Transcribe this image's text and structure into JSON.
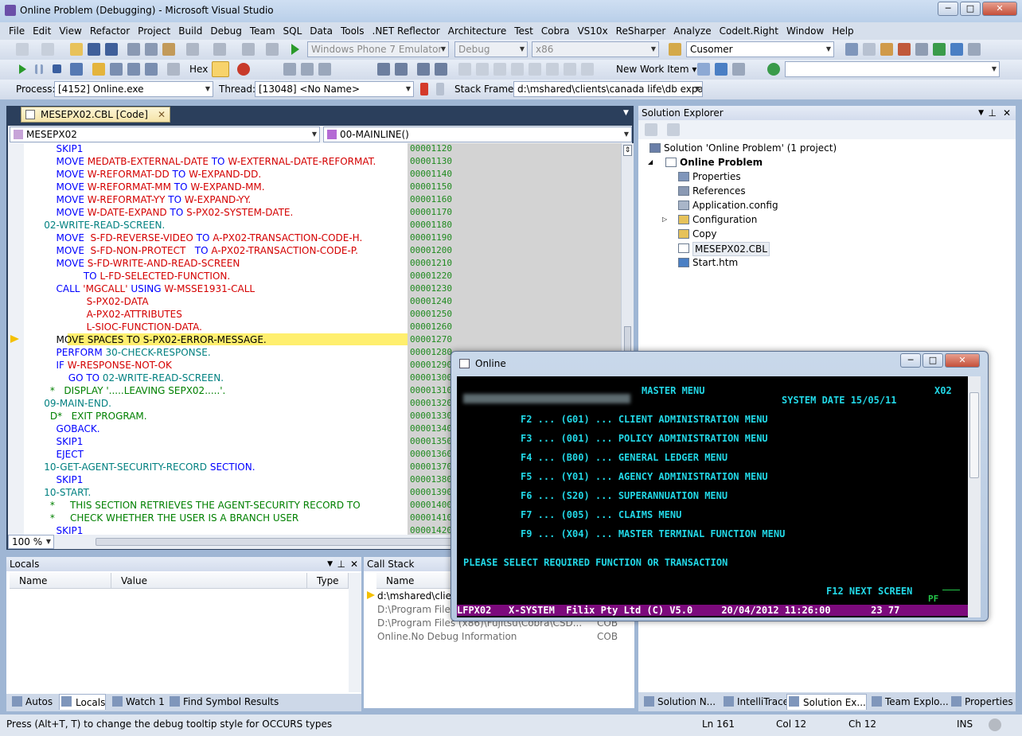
{
  "window": {
    "title": "Online Problem (Debugging) - Microsoft Visual Studio"
  },
  "menu": [
    "File",
    "Edit",
    "View",
    "Refactor",
    "Project",
    "Build",
    "Debug",
    "Team",
    "SQL",
    "Data",
    "Tools",
    ".NET Reflector",
    "Architecture",
    "Test",
    "Cobra",
    "VS10x",
    "ReSharper",
    "Analyze",
    "CodeIt.Right",
    "Window",
    "Help"
  ],
  "toolbar1": {
    "device": "Windows Phone 7 Emulator",
    "config": "Debug",
    "platform": "x86",
    "find": "Cusomer"
  },
  "toolbar2": {
    "hex": "Hex",
    "new_work_item": "New Work Item"
  },
  "toolbar3": {
    "process_label": "Process:",
    "process": "[4152] Online.exe",
    "thread_label": "Thread:",
    "thread": "[13048] <No Name>",
    "stack_label": "Stack Frame:",
    "stack": "d:\\mshared\\clients\\canada life\\db expans"
  },
  "editor": {
    "tab": "MESEPX02.CBL [Code]",
    "nav_left": "MESEPX02",
    "nav_right": "00-MAINLINE()",
    "zoom": "100 %",
    "lines": [
      {
        "n": "00001120",
        "segs": [
          [
            "        SKIP1",
            "kw"
          ]
        ]
      },
      {
        "n": "00001130",
        "segs": [
          [
            "        MOVE ",
            "kw"
          ],
          [
            "MEDATB-EXTERNAL-DATE ",
            "id"
          ],
          [
            "TO ",
            "kw"
          ],
          [
            "W-EXTERNAL-DATE-REFORMAT.",
            "id"
          ]
        ]
      },
      {
        "n": "00001140",
        "segs": [
          [
            "        MOVE ",
            "kw"
          ],
          [
            "W-REFORMAT-DD ",
            "id"
          ],
          [
            "TO ",
            "kw"
          ],
          [
            "W-EXPAND-DD.",
            "id"
          ]
        ]
      },
      {
        "n": "00001150",
        "segs": [
          [
            "        MOVE ",
            "kw"
          ],
          [
            "W-REFORMAT-MM ",
            "id"
          ],
          [
            "TO ",
            "kw"
          ],
          [
            "W-EXPAND-MM.",
            "id"
          ]
        ]
      },
      {
        "n": "00001160",
        "segs": [
          [
            "        MOVE ",
            "kw"
          ],
          [
            "W-REFORMAT-YY ",
            "id"
          ],
          [
            "TO ",
            "kw"
          ],
          [
            "W-EXPAND-YY.",
            "id"
          ]
        ]
      },
      {
        "n": "00001170",
        "segs": [
          [
            "        MOVE ",
            "kw"
          ],
          [
            "W-DATE-EXPAND ",
            "id"
          ],
          [
            "TO ",
            "kw"
          ],
          [
            "S-PX02-SYSTEM-DATE.",
            "id"
          ]
        ]
      },
      {
        "n": "00001180",
        "segs": [
          [
            "    02-WRITE-READ-SCREEN.",
            "sec"
          ]
        ]
      },
      {
        "n": "00001190",
        "segs": [
          [
            "        MOVE  ",
            "kw"
          ],
          [
            "S-FD-REVERSE-VIDEO ",
            "id"
          ],
          [
            "TO ",
            "kw"
          ],
          [
            "A-PX02-TRANSACTION-CODE-H.",
            "id"
          ]
        ]
      },
      {
        "n": "00001200",
        "segs": [
          [
            "        MOVE  ",
            "kw"
          ],
          [
            "S-FD-NON-PROTECT   ",
            "id"
          ],
          [
            "TO ",
            "kw"
          ],
          [
            "A-PX02-TRANSACTION-CODE-P.",
            "id"
          ]
        ]
      },
      {
        "n": "00001210",
        "segs": [
          [
            "        MOVE ",
            "kw"
          ],
          [
            "S-FD-WRITE-AND-READ-SCREEN",
            "id"
          ]
        ]
      },
      {
        "n": "00001220",
        "segs": [
          [
            "                 TO ",
            "kw"
          ],
          [
            "L-FD-SELECTED-FUNCTION.",
            "id"
          ]
        ]
      },
      {
        "n": "00001230",
        "segs": [
          [
            "        CALL ",
            "kw"
          ],
          [
            "'MGCALL' ",
            "str"
          ],
          [
            "USING ",
            "kw"
          ],
          [
            "W-MSSE1931-CALL",
            "id"
          ]
        ]
      },
      {
        "n": "00001240",
        "segs": [
          [
            "                  S-PX02-DATA",
            "id"
          ]
        ]
      },
      {
        "n": "00001250",
        "segs": [
          [
            "                  A-PX02-ATTRIBUTES",
            "id"
          ]
        ]
      },
      {
        "n": "00001260",
        "segs": [
          [
            "                  L-SIOC-FUNCTION-DATA.",
            "id"
          ]
        ]
      },
      {
        "n": "00001270",
        "segs": [
          [
            "        MOVE SPACES TO S-PX02-ERROR-MESSAGE.",
            "cur"
          ]
        ]
      },
      {
        "n": "00001280",
        "segs": [
          [
            "        PERFORM ",
            "kw"
          ],
          [
            "30-CHECK-RESPONSE.",
            "sec"
          ]
        ]
      },
      {
        "n": "00001290",
        "segs": [
          [
            "        IF ",
            "kw"
          ],
          [
            "W-RESPONSE-NOT-OK",
            "id"
          ]
        ]
      },
      {
        "n": "00001300",
        "segs": [
          [
            "            GO TO ",
            "kw"
          ],
          [
            "02-WRITE-READ-SCREEN.",
            "sec"
          ]
        ]
      },
      {
        "n": "00001310",
        "segs": [
          [
            "      *   DISPLAY '.....LEAVING SEPX02.....'.",
            "com"
          ]
        ]
      },
      {
        "n": "00001320",
        "segs": [
          [
            "    09-MAIN-END.",
            "sec"
          ]
        ]
      },
      {
        "n": "00001330",
        "segs": [
          [
            "      D*   EXIT PROGRAM.",
            "com"
          ]
        ]
      },
      {
        "n": "00001340",
        "segs": [
          [
            "        GOBACK.",
            "kw"
          ]
        ]
      },
      {
        "n": "00001350",
        "segs": [
          [
            "        SKIP1",
            "kw"
          ]
        ]
      },
      {
        "n": "00001360",
        "segs": [
          [
            "        EJECT",
            "kw"
          ]
        ]
      },
      {
        "n": "00001370",
        "segs": [
          [
            "    10-GET-AGENT-SECURITY-RECORD ",
            "sec"
          ],
          [
            "SECTION.",
            "kw"
          ]
        ]
      },
      {
        "n": "00001380",
        "segs": [
          [
            "        SKIP1",
            "kw"
          ]
        ]
      },
      {
        "n": "00001390",
        "segs": [
          [
            "    10-START.",
            "sec"
          ]
        ]
      },
      {
        "n": "00001400",
        "segs": [
          [
            "      *     THIS SECTION RETRIEVES THE AGENT-SECURITY RECORD TO",
            "com"
          ]
        ]
      },
      {
        "n": "00001410",
        "segs": [
          [
            "      *     CHECK WHETHER THE USER IS A BRANCH USER",
            "com"
          ]
        ]
      },
      {
        "n": "00001420",
        "segs": [
          [
            "        SKIP1",
            "kw"
          ]
        ]
      }
    ]
  },
  "solution_explorer": {
    "title": "Solution Explorer",
    "items": [
      {
        "label": "Solution 'Online Problem' (1 project)",
        "icon": "solution-icon"
      },
      {
        "label": "Online Problem",
        "icon": "cobol-project-icon"
      },
      {
        "label": "Properties",
        "icon": "properties-icon"
      },
      {
        "label": "References",
        "icon": "references-icon"
      },
      {
        "label": "Application.config",
        "icon": "config-file-icon"
      },
      {
        "label": "Configuration",
        "icon": "folder-icon"
      },
      {
        "label": "Copy",
        "icon": "folder-icon"
      },
      {
        "label": "MESEPX02.CBL",
        "icon": "cobol-file-icon"
      },
      {
        "label": "Start.htm",
        "icon": "html-file-icon"
      }
    ]
  },
  "locals": {
    "title": "Locals",
    "cols": [
      "Name",
      "Value",
      "Type"
    ]
  },
  "callstack": {
    "title": "Call Stack",
    "col": "Name",
    "rows": [
      {
        "name": "d:\\mshared\\clients",
        "lang": ""
      },
      {
        "name": "D:\\Program Files",
        "lang": ""
      },
      {
        "name": "D:\\Program Files (x86)\\Fujitsu\\Cobra\\CSD...",
        "lang": "COB"
      },
      {
        "name": "Online.No Debug Information",
        "lang": "COB"
      }
    ]
  },
  "bottom_tabs_left": [
    "Autos",
    "Locals",
    "Watch 1",
    "Find Symbol Results"
  ],
  "bottom_tabs_right": [
    "Solution N...",
    "IntelliTrace",
    "Solution Ex...",
    "Team Explo...",
    "Properties"
  ],
  "status": {
    "message": "Press (Alt+T, T) to change the debug tooltip style for OCCURS types",
    "ln": "Ln 161",
    "col": "Col 12",
    "ch": "Ch 12",
    "ins": "INS"
  },
  "online": {
    "title": "Online",
    "header": "MASTER MENU",
    "sysdate": "SYSTEM DATE 15/05/11",
    "code": "X02",
    "items": [
      "F2 ... (G01) ... CLIENT ADMINISTRATION MENU",
      "F3 ... (001) ... POLICY ADMINISTRATION MENU",
      "F4 ... (B00) ... GENERAL LEDGER MENU",
      "F5 ... (Y01) ... AGENCY ADMINISTRATION MENU",
      "F6 ... (S20) ... SUPERANNUATION MENU",
      "F7 ... (005) ... CLAIMS MENU",
      "F9 ... (X04) ... MASTER TERMINAL FUNCTION MENU"
    ],
    "prompt": "PLEASE SELECT REQUIRED FUNCTION OR TRANSACTION",
    "f12": "F12 NEXT SCREEN",
    "pf": "PF",
    "statusline": "LFPX02   X-SYSTEM  Filix Pty Ltd (C) V5.0     20/04/2012 11:26:00       23 77"
  },
  "colors": {
    "keyword": "#0000ff",
    "identifier": "#d40000",
    "section": "#008080",
    "comment": "#008000",
    "lineno": "#1f8a1f",
    "terminal_text": "#22d7e6",
    "terminal_status": "#7c0a7c"
  }
}
